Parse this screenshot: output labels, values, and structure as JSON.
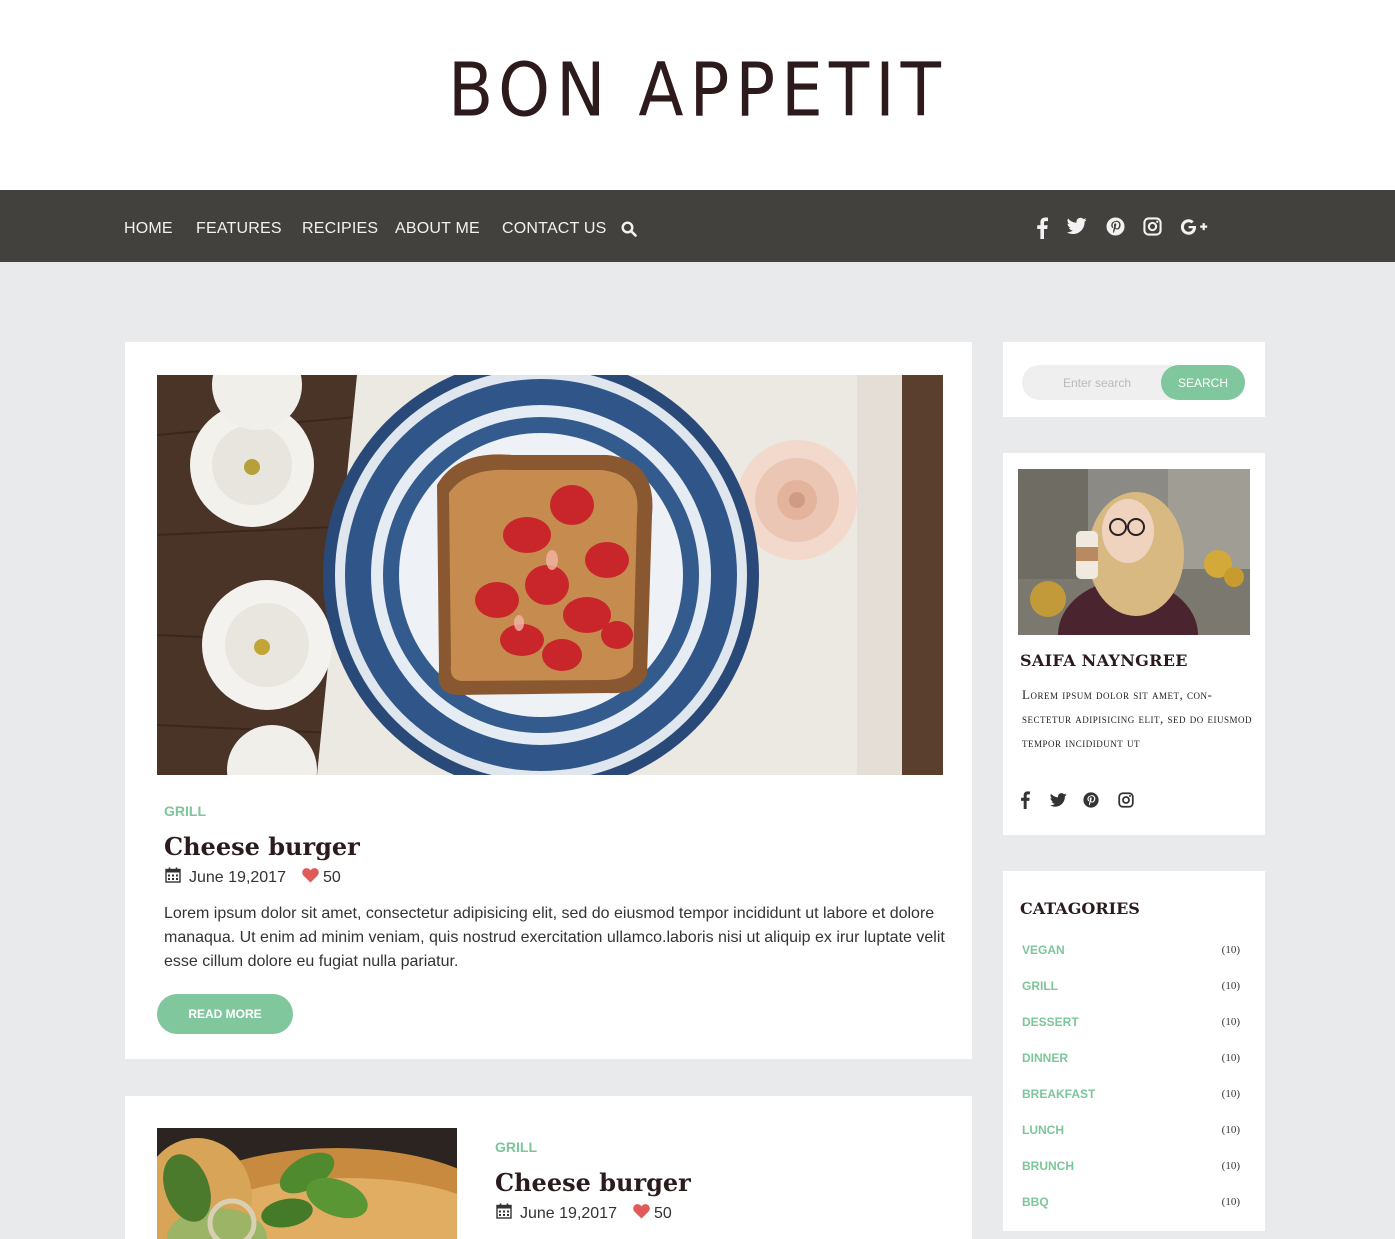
{
  "header": {
    "logo": "BON APPETIT"
  },
  "nav": {
    "items": [
      "HOME",
      "FEATURES",
      "RECIPIES",
      "ABOUT ME",
      "CONTACT US"
    ],
    "search_icon": "search-icon",
    "social": [
      "facebook-icon",
      "twitter-icon",
      "pinterest-icon",
      "instagram-icon",
      "google-plus-icon"
    ]
  },
  "posts": [
    {
      "category": "GRILL",
      "title": "Cheese burger",
      "date": "June 19,2017",
      "likes": "50",
      "excerpt": "Lorem ipsum dolor sit amet, consectetur adipisicing elit, sed do eiusmod tempor incididunt ut labore et dolore manaqua. Ut enim ad minim veniam, quis nostrud exercitation ullamco.laboris nisi ut aliquip ex  irur luptate velit esse cillum dolore eu fugiat nulla pariatur.",
      "read_more": "READ MORE"
    },
    {
      "category": "GRILL",
      "title": "Cheese burger",
      "date": "June 19,2017",
      "likes": "50"
    }
  ],
  "sidebar": {
    "search": {
      "placeholder": "Enter search",
      "button": "SEARCH"
    },
    "about": {
      "name": "SAIFA NAYNGREE",
      "bio": "Lorem ipsum dolor sit amet, con-sectetur adipisicing elit, sed do eiusmod tempor incididunt ut",
      "social": [
        "facebook-icon",
        "twitter-icon",
        "pinterest-icon",
        "instagram-icon"
      ]
    },
    "categories": {
      "title": "CATAGORIES",
      "items": [
        {
          "name": "VEGAN",
          "count": "(10)"
        },
        {
          "name": "GRILL",
          "count": "(10)"
        },
        {
          "name": "DESSERT",
          "count": "(10)"
        },
        {
          "name": "DINNER",
          "count": "(10)"
        },
        {
          "name": "BREAKFAST",
          "count": "(10)"
        },
        {
          "name": "LUNCH",
          "count": "(10)"
        },
        {
          "name": "BRUNCH",
          "count": "(10)"
        },
        {
          "name": "BBQ",
          "count": "(10)"
        }
      ]
    }
  },
  "colors": {
    "accent": "#80c79d",
    "nav_bg": "#43413d",
    "page_bg": "#e9eaec",
    "heart": "#e05a5a"
  }
}
